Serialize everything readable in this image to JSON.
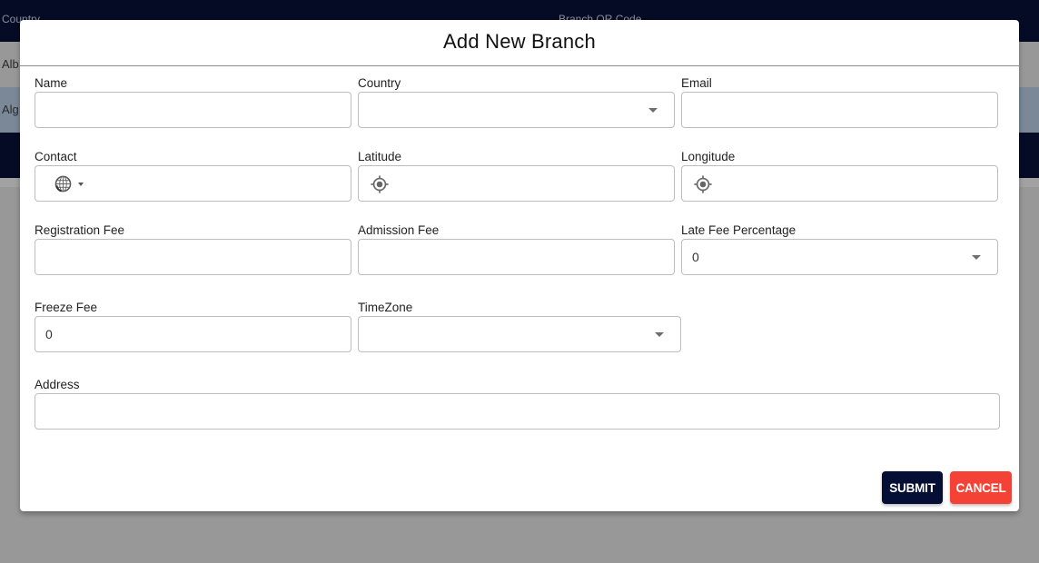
{
  "background": {
    "table_headers": [
      "Country",
      "Branch QR Code"
    ],
    "rows": [
      "Alb",
      "Alg"
    ]
  },
  "modal": {
    "title": "Add New Branch",
    "fields": {
      "name": {
        "label": "Name",
        "value": ""
      },
      "country": {
        "label": "Country",
        "value": ""
      },
      "email": {
        "label": "Email",
        "value": ""
      },
      "contact": {
        "label": "Contact",
        "value": "",
        "icon": "globe-icon"
      },
      "latitude": {
        "label": "Latitude",
        "value": "",
        "icon": "gps-target-icon"
      },
      "longitude": {
        "label": "Longitude",
        "value": "",
        "icon": "gps-target-icon"
      },
      "registration_fee": {
        "label": "Registration Fee",
        "value": ""
      },
      "admission_fee": {
        "label": "Admission Fee",
        "value": ""
      },
      "late_fee_percentage": {
        "label": "Late Fee Percentage",
        "value": "0"
      },
      "freeze_fee": {
        "label": "Freeze Fee",
        "value": "0"
      },
      "timezone": {
        "label": "TimeZone",
        "value": ""
      },
      "address": {
        "label": "Address",
        "value": ""
      }
    },
    "buttons": {
      "submit": "SUBMIT",
      "cancel": "CANCEL"
    }
  },
  "colors": {
    "submit": "#050f36",
    "cancel": "#f44336",
    "header": "#050b24"
  }
}
